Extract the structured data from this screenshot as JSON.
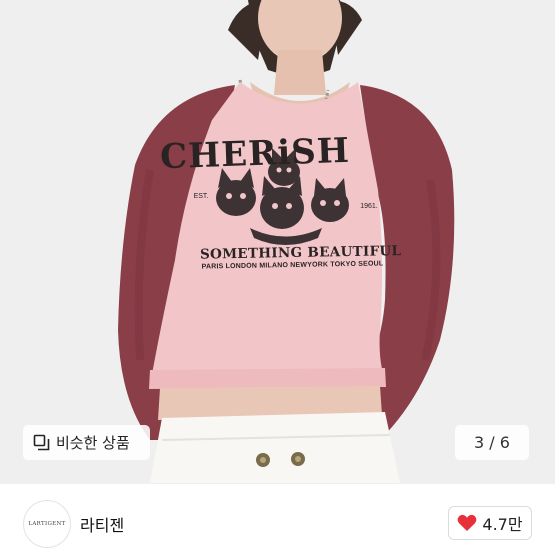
{
  "product_image": {
    "alt": "",
    "shirt_print": {
      "title": "CHERiSH",
      "subtitle": "SOMETHING BEAUTIFUL",
      "cities": "PARIS LONDON MILANO NEWYORK TOKYO SEOUL",
      "est": "EST.",
      "year": "1961."
    }
  },
  "similar_products_button": {
    "label": "비슷한 상품",
    "icon": "similar-items-icon"
  },
  "image_counter": {
    "text": "3 / 6"
  },
  "brand": {
    "logo_text": "LARTIGENT",
    "name": "라티젠"
  },
  "like": {
    "count": "4.7만",
    "icon": "heart-icon",
    "color": "#e8303a"
  },
  "colors": {
    "shirt_body": "#f2c6c8",
    "shirt_sleeves": "#8a3f48"
  }
}
